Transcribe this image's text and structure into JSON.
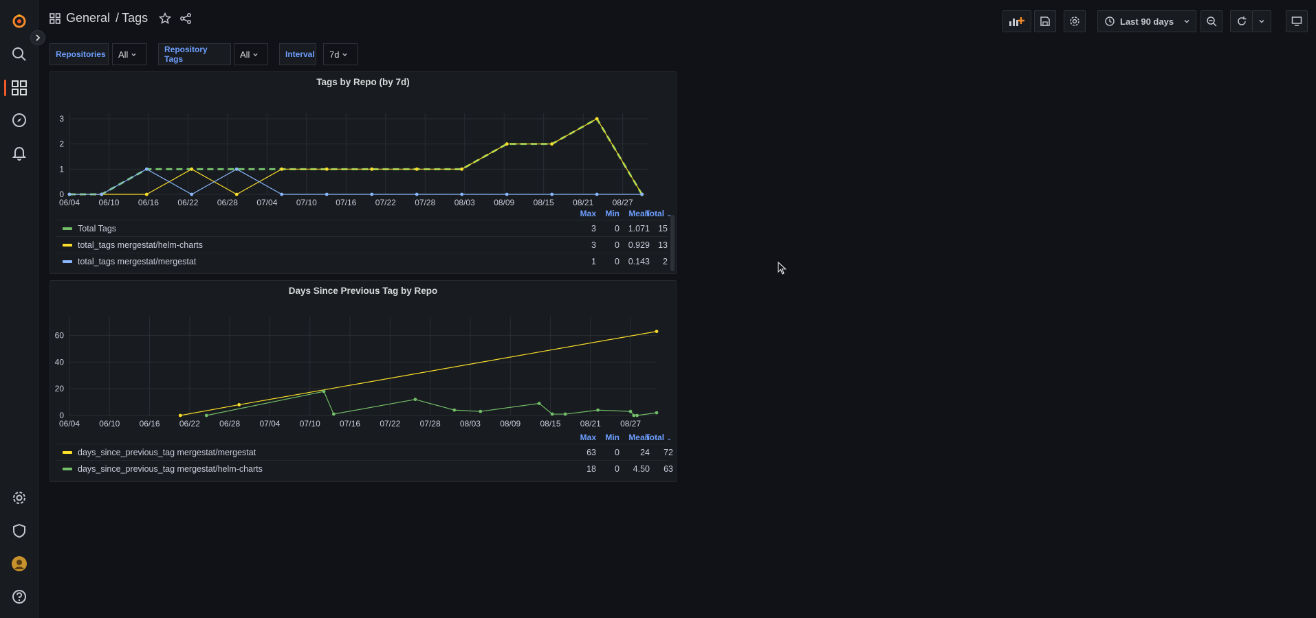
{
  "breadcrumb": {
    "folder": "General",
    "separator": "/",
    "dashboard": "Tags"
  },
  "toolbar": {
    "time_range": "Last 90 days"
  },
  "variables": [
    {
      "label": "Repositories",
      "value": "All"
    },
    {
      "label": "Repository Tags",
      "value": "All"
    },
    {
      "label": "Interval",
      "value": "7d"
    }
  ],
  "icons": {
    "logo": "grafana-logo-icon",
    "search": "search-icon",
    "dashboards": "dashboards-icon",
    "explore": "compass-icon",
    "alerting": "bell-icon",
    "config": "gear-icon",
    "admin": "shield-icon",
    "help": "help-icon"
  },
  "colors": {
    "green": "#73bf69",
    "yellow": "#fade2a",
    "blue": "#8ab8ff",
    "accent": "#f05a28",
    "link": "#6e9fff"
  },
  "legend_headers": {
    "max": "Max",
    "min": "Min",
    "mean": "Mean",
    "total": "Total"
  },
  "panels": [
    {
      "title": "Tags by Repo (by 7d)",
      "legend": [
        {
          "name": "Total Tags",
          "color": "#73bf69",
          "max": "3",
          "min": "0",
          "mean": "1.071",
          "total": "15"
        },
        {
          "name": "total_tags mergestat/helm-charts",
          "color": "#fade2a",
          "max": "3",
          "min": "0",
          "mean": "0.929",
          "total": "13"
        },
        {
          "name": "total_tags mergestat/mergestat",
          "color": "#8ab8ff",
          "max": "1",
          "min": "0",
          "mean": "0.143",
          "total": "2"
        }
      ]
    },
    {
      "title": "Days Since Previous Tag by Repo",
      "legend": [
        {
          "name": "days_since_previous_tag mergestat/mergestat",
          "color": "#fade2a",
          "max": "63",
          "min": "0",
          "mean": "24",
          "total": "72"
        },
        {
          "name": "days_since_previous_tag mergestat/helm-charts",
          "color": "#73bf69",
          "max": "18",
          "min": "0",
          "mean": "4.50",
          "total": "63"
        }
      ]
    }
  ],
  "chart_data": [
    {
      "type": "line",
      "title": "Tags by Repo (by 7d)",
      "x_ticks": [
        "06/04",
        "06/10",
        "06/16",
        "06/22",
        "06/28",
        "07/04",
        "07/10",
        "07/16",
        "07/22",
        "07/28",
        "08/03",
        "08/09",
        "08/15",
        "08/21",
        "08/27"
      ],
      "x_range": [
        0,
        90
      ],
      "ylim": [
        0,
        3
      ],
      "y_ticks": [
        0,
        1,
        2,
        3
      ],
      "grid": true,
      "series": [
        {
          "name": "Total Tags",
          "color": "#73bf69",
          "dashed": true,
          "x": [
            0,
            5,
            12,
            19,
            26,
            33,
            40,
            47,
            54,
            61,
            68,
            75,
            82,
            89
          ],
          "y": [
            0,
            0,
            1,
            1,
            1,
            1,
            1,
            1,
            1,
            1,
            2,
            2,
            3,
            0
          ]
        },
        {
          "name": "total_tags mergestat/helm-charts",
          "color": "#fade2a",
          "dashed": false,
          "x": [
            0,
            5,
            12,
            19,
            26,
            33,
            40,
            47,
            54,
            61,
            68,
            75,
            82,
            89
          ],
          "y": [
            0,
            0,
            0,
            1,
            0,
            1,
            1,
            1,
            1,
            1,
            2,
            2,
            3,
            0
          ]
        },
        {
          "name": "total_tags mergestat/mergestat",
          "color": "#8ab8ff",
          "dashed": false,
          "x": [
            0,
            5,
            12,
            19,
            26,
            33,
            40,
            47,
            54,
            61,
            68,
            75,
            82,
            89
          ],
          "y": [
            0,
            0,
            1,
            0,
            1,
            0,
            0,
            0,
            0,
            0,
            0,
            0,
            0,
            0
          ]
        }
      ]
    },
    {
      "type": "line",
      "title": "Days Since Previous Tag by Repo",
      "x_ticks": [
        "06/04",
        "06/10",
        "06/16",
        "06/22",
        "06/28",
        "07/04",
        "07/10",
        "07/16",
        "07/22",
        "07/28",
        "08/03",
        "08/09",
        "08/15",
        "08/21",
        "08/27"
      ],
      "x_range": [
        0,
        90
      ],
      "ylim": [
        0,
        70
      ],
      "y_ticks": [
        0,
        20,
        40,
        60
      ],
      "grid": true,
      "series": [
        {
          "name": "days_since_previous_tag mergestat/mergestat",
          "color": "#fade2a",
          "x": [
            17,
            26,
            90
          ],
          "y": [
            0,
            8,
            63
          ]
        },
        {
          "name": "days_since_previous_tag mergestat/helm-charts",
          "color": "#73bf69",
          "x": [
            21,
            39,
            40.5,
            53,
            59,
            63,
            72,
            74,
            76,
            81,
            86,
            86.5,
            87,
            90
          ],
          "y": [
            0,
            18,
            1,
            12,
            4,
            3,
            9,
            1,
            1,
            4,
            3,
            0,
            0,
            2
          ]
        }
      ]
    }
  ]
}
